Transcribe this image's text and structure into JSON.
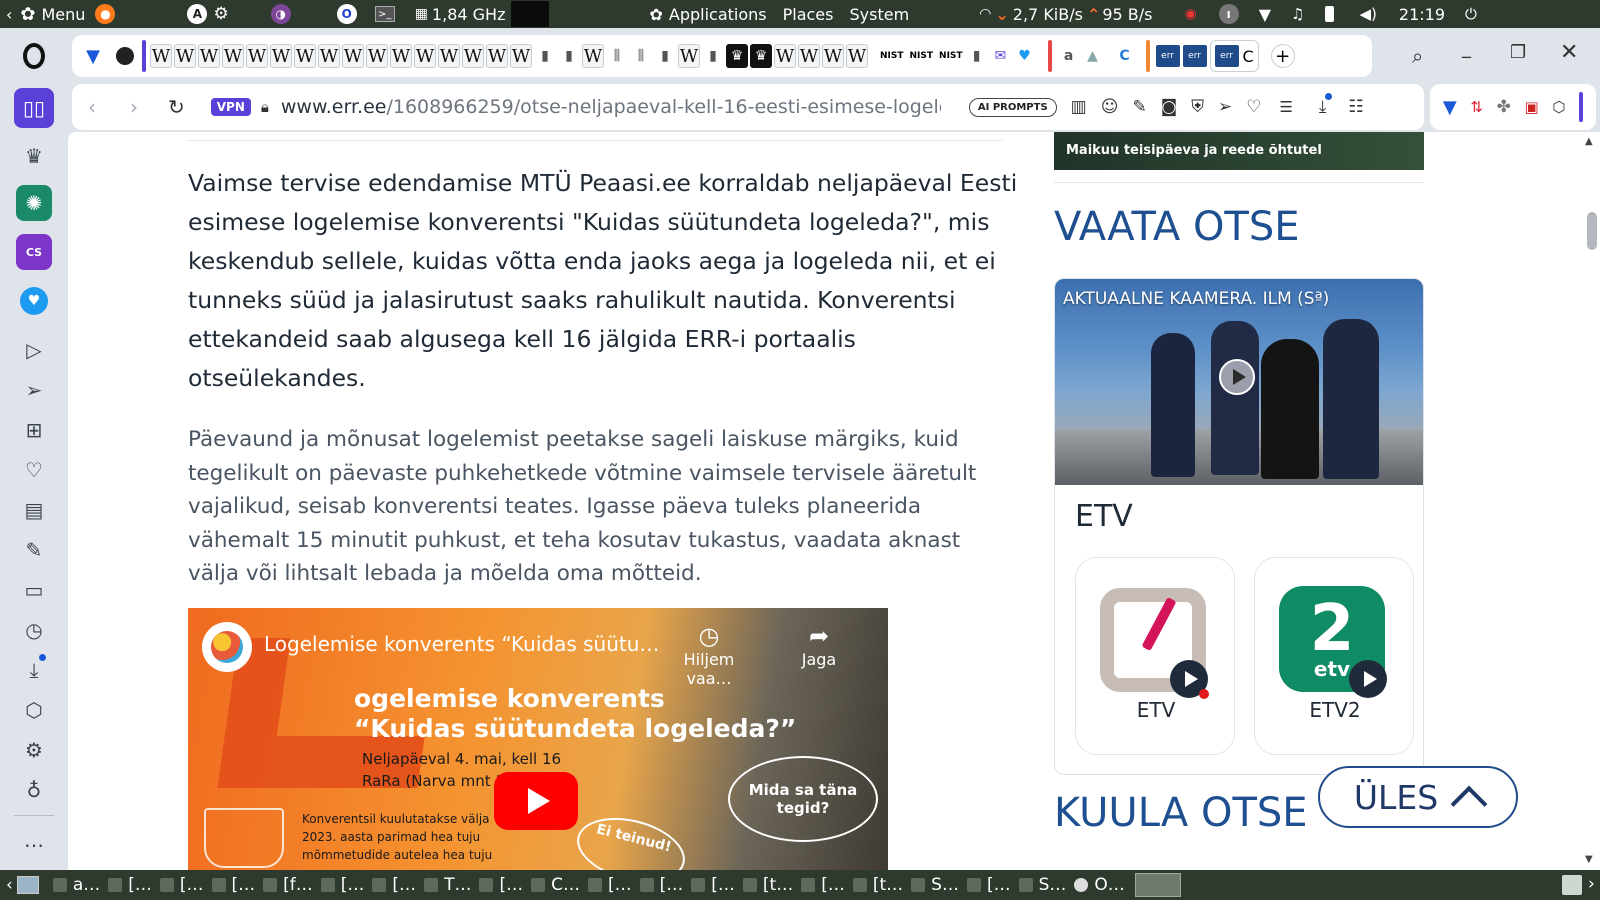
{
  "system_panel": {
    "menu_label": "Menu",
    "cpu_freq": "1,84 GHz",
    "applications": "Applications",
    "places": "Places",
    "system": "System",
    "net_down": "2,7 KiB/s",
    "net_up": "95 B/s",
    "clock": "21:19"
  },
  "tabs": {
    "wiki_glyph": "W",
    "nist_label": "NIST",
    "amazon_glyph": "a",
    "err_label": "err",
    "partial_tab": "C"
  },
  "address_bar": {
    "vpn_label": "VPN",
    "url_domain": "www.err.ee",
    "url_path": "/1608966259/otse-neljapaeval-kell-16-eesti-esimese-logelen",
    "ai_prompts_label": "AI PROMPTS"
  },
  "sidebar": {
    "more_label": "…"
  },
  "article": {
    "paragraph_1": "Vaimse tervise edendamise MTÜ Peaasi.ee korraldab neljapäeval Eesti esimese logelemise konverentsi \"Kuidas süütundeta logeleda?\", mis keskendub sellele, kuidas võtta enda jaoks aega ja logeleda nii, et ei tunneks süüd ja jalasirutust saaks rahulikult nautida. Konverentsi ettekandeid saab algusega kell 16 jälgida ERR-i portaalis otseülekandes.",
    "paragraph_2": "Päevaund ja mõnusat logelemist peetakse sageli laiskuse märgiks, kuid tegelikult on päevaste puhkehetkede võtmine vaimsele tervisele ääretult vajalikud, seisab konverentsi teates. Igasse päeva tuleks planeerida vähemalt 15 minutit puhkust, et teha kosutav tukastus, vaadata aknast välja või lihtsalt lebada ja mõelda oma mõtteid."
  },
  "video": {
    "title": "Logelemise konverents “Kuidas süütu…",
    "watch_later": "Hiljem vaa…",
    "share": "Jaga",
    "poster_line_1": "ogelemise konverents",
    "poster_line_2": "“Kuidas süütundeta logeleda?”",
    "poster_date": "Neljapäeval 4. mai, kell 16",
    "poster_venue": "RaRa (Narva mnt 1",
    "poster_small_1": "Konverentsil kuulutatakse välja",
    "poster_small_2": "2023. aasta parimad hea tuju",
    "poster_small_3": "mõmmetudide autelea hea tuju",
    "bubble_1": "Mida sa täna tegid?",
    "bubble_2": "Ei teinud!"
  },
  "sidebar_right": {
    "banner_text": "Maikuu teisipäeva ja reede õhtutel",
    "live_heading": "VAATA OTSE",
    "live_show": "AKTUAALNE KAAMERA. ILM (Sª)",
    "channel_heading": "ETV",
    "channels": [
      {
        "name": "ETV"
      },
      {
        "name": "ETV2"
      }
    ],
    "up_button": "ÜLES",
    "listen_heading": "KUULA OTSE"
  },
  "taskbar": {
    "items": [
      "a…",
      "[…",
      "[…",
      "[…",
      "[f…",
      "[…",
      "[…",
      "T…",
      "[…",
      "C…",
      "[…",
      "[…",
      "[…",
      "[t…",
      "[…",
      "[t…",
      "S…",
      "[…",
      "S…",
      "O…"
    ]
  },
  "colors": {
    "panel_bg": "#2f3a2f",
    "err_blue": "#1f4b8a",
    "heading_blue": "#1d4f91",
    "etv_green": "#0f8c66",
    "etv_magenta": "#d4145a",
    "vpn_purple": "#5b3fd9"
  }
}
